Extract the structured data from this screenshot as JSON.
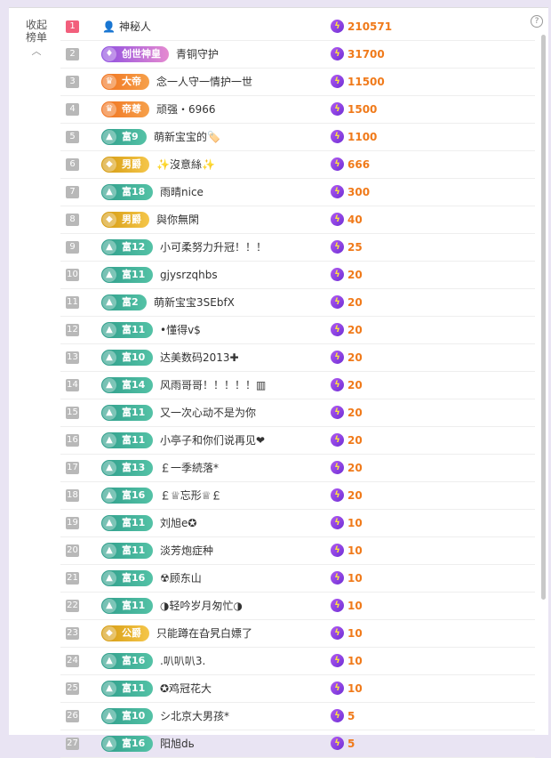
{
  "panel": {
    "collapse_label": "收起榜单",
    "help_icon": "question-circle-icon",
    "colors": {
      "rank_first": "#f25f7c",
      "rank_other": "#b8b8b8",
      "score": "#f07a1a",
      "bolt": "#8e44e8"
    }
  },
  "rows": [
    {
      "rank": "1",
      "badge": "",
      "badge_type": "mystery",
      "name": "神秘人",
      "score": "210571"
    },
    {
      "rank": "2",
      "badge": "创世神皇",
      "badge_type": "creator",
      "name": "青铜守护",
      "score": "31700"
    },
    {
      "rank": "3",
      "badge": "大帝",
      "badge_type": "emperor",
      "name": "念一人守一情护一世",
      "score": "11500"
    },
    {
      "rank": "4",
      "badge": "帝尊",
      "badge_type": "emperor",
      "name": "顽强・6966",
      "score": "1500"
    },
    {
      "rank": "5",
      "badge": "富9",
      "badge_type": "rich",
      "name": "萌新宝宝的🏷️",
      "score": "1100"
    },
    {
      "rank": "6",
      "badge": "男爵",
      "badge_type": "noble",
      "name": "✨沒意絲✨",
      "score": "666"
    },
    {
      "rank": "7",
      "badge": "富18",
      "badge_type": "rich",
      "name": "雨晴nice",
      "score": "300"
    },
    {
      "rank": "8",
      "badge": "男爵",
      "badge_type": "noble",
      "name": "與你無閑",
      "score": "40"
    },
    {
      "rank": "9",
      "badge": "富12",
      "badge_type": "rich",
      "name": "小可柔努力升冠！！！",
      "score": "25"
    },
    {
      "rank": "10",
      "badge": "富11",
      "badge_type": "rich",
      "name": "gjysrzqhbs",
      "score": "20"
    },
    {
      "rank": "11",
      "badge": "富2",
      "badge_type": "rich",
      "name": "萌新宝宝3SEbfX",
      "score": "20"
    },
    {
      "rank": "12",
      "badge": "富11",
      "badge_type": "rich",
      "name": "•懂得v$",
      "score": "20"
    },
    {
      "rank": "13",
      "badge": "富10",
      "badge_type": "rich",
      "name": "达美数码2013✚",
      "score": "20"
    },
    {
      "rank": "14",
      "badge": "富14",
      "badge_type": "rich",
      "name": "风雨哥哥！！！！！▥",
      "score": "20"
    },
    {
      "rank": "15",
      "badge": "富11",
      "badge_type": "rich",
      "name": "又一次心动不是为你",
      "score": "20"
    },
    {
      "rank": "16",
      "badge": "富11",
      "badge_type": "rich",
      "name": "小亭子和你们说再见❤",
      "score": "20"
    },
    {
      "rank": "17",
      "badge": "富13",
      "badge_type": "rich",
      "name": "￡一季続落*",
      "score": "20"
    },
    {
      "rank": "18",
      "badge": "富16",
      "badge_type": "rich",
      "name": "￡♕忘形♕￡",
      "score": "20"
    },
    {
      "rank": "19",
      "badge": "富11",
      "badge_type": "rich",
      "name": "刘旭e✪",
      "score": "10"
    },
    {
      "rank": "20",
      "badge": "富11",
      "badge_type": "rich",
      "name": "淡芳炮症种",
      "score": "10"
    },
    {
      "rank": "21",
      "badge": "富16",
      "badge_type": "rich",
      "name": "☢顾东山",
      "score": "10"
    },
    {
      "rank": "22",
      "badge": "富11",
      "badge_type": "rich",
      "name": "◑轻吟岁月匆忙◑",
      "score": "10"
    },
    {
      "rank": "23",
      "badge": "公爵",
      "badge_type": "noble",
      "name": "只能蹲在旮旯白嫖了",
      "score": "10"
    },
    {
      "rank": "24",
      "badge": "富16",
      "badge_type": "rich",
      "name": ".叭叭叭3.",
      "score": "10"
    },
    {
      "rank": "25",
      "badge": "富11",
      "badge_type": "rich",
      "name": "✪鸡冠花大",
      "score": "10"
    },
    {
      "rank": "26",
      "badge": "富10",
      "badge_type": "rich",
      "name": "シ北京大男孩*",
      "score": "5"
    },
    {
      "rank": "27",
      "badge": "富16",
      "badge_type": "rich",
      "name": "阳旭dь",
      "score": "5"
    }
  ]
}
